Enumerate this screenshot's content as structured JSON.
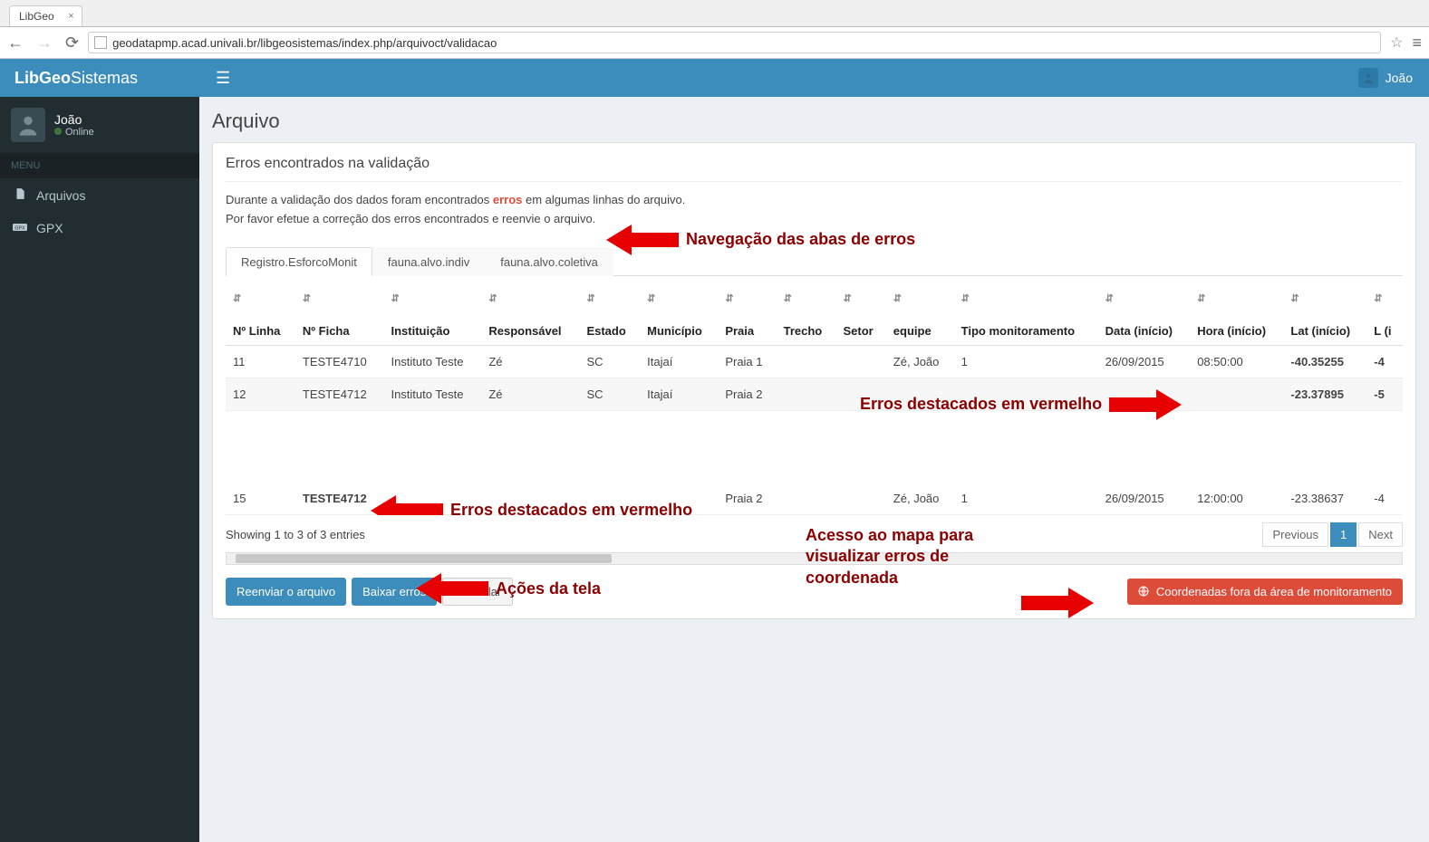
{
  "browser": {
    "tab_title": "LibGeo",
    "url": "geodatapmp.acad.univali.br/libgeosistemas/index.php/arquivoct/validacao"
  },
  "header": {
    "logo_bold": "LibGeo",
    "logo_light": "Sistemas",
    "user": "João"
  },
  "sidebar": {
    "user_name": "João",
    "user_status": "Online",
    "menu_label": "MENU",
    "items": [
      {
        "label": "Arquivos",
        "icon": "file"
      },
      {
        "label": "GPX",
        "icon": "gpx"
      }
    ]
  },
  "main": {
    "page_title": "Arquivo",
    "box_title": "Erros encontrados na validação",
    "info_line1_before": "Durante a validação dos dados foram encontrados ",
    "info_line1_err": "erros",
    "info_line1_after": " em algumas linhas do arquivo.",
    "info_line2": "Por favor efetue a correção dos erros encontrados e reenvie o arquivo.",
    "tabs": [
      {
        "label": "Registro.EsforcoMonit",
        "active": true
      },
      {
        "label": "fauna.alvo.indiv",
        "active": false
      },
      {
        "label": "fauna.alvo.coletiva",
        "active": false
      }
    ],
    "table": {
      "headers": [
        "Nº Linha",
        "Nº Ficha",
        "Instituição",
        "Responsável",
        "Estado",
        "Município",
        "Praia",
        "Trecho",
        "Setor",
        "equipe",
        "Tipo monitoramento",
        "Data (início)",
        "Hora (início)",
        "Lat (início)",
        "L (i"
      ],
      "rows": [
        {
          "linha": "11",
          "ficha": "TESTE4710",
          "ficha_err": false,
          "inst": "Instituto Teste",
          "resp": "Zé",
          "estado": "SC",
          "mun": "Itajaí",
          "praia": "Praia 1",
          "trecho": "",
          "setor": "",
          "equipe": "Zé, João",
          "tipo": "1",
          "data": "26/09/2015",
          "hora": "08:50:00",
          "lat": "-40.35255",
          "lat_err": true,
          "lon": "-4",
          "lon_err": true
        },
        {
          "linha": "12",
          "ficha": "TESTE4712",
          "ficha_err": false,
          "inst": "Instituto Teste",
          "resp": "Zé",
          "estado": "SC",
          "mun": "Itajaí",
          "praia": "Praia 2",
          "trecho": "",
          "setor": "",
          "equipe": "",
          "tipo": "",
          "data": "",
          "hora": "",
          "lat": "-23.37895",
          "lat_err": true,
          "lon": "-5",
          "lon_err": true
        },
        {
          "linha": "15",
          "ficha": "TESTE4712",
          "ficha_err": true,
          "inst": "",
          "resp": "",
          "estado": "",
          "mun": "",
          "praia": "Praia 2",
          "trecho": "",
          "setor": "",
          "equipe": "Zé, João",
          "tipo": "1",
          "data": "26/09/2015",
          "hora": "12:00:00",
          "lat": "-23.38637",
          "lat_err": false,
          "lon": "-4",
          "lon_err": false
        }
      ]
    },
    "entries_info": "Showing 1 to 3 of 3 entries",
    "pagination": {
      "prev": "Previous",
      "page": "1",
      "next": "Next"
    },
    "buttons": {
      "reenviar": "Reenviar o arquivo",
      "baixar": "Baixar erros",
      "cancelar": "Cancelar",
      "coord": "Coordenadas fora da área de monitoramento"
    }
  },
  "annotations": {
    "nav_tabs": "Navegação das abas de erros",
    "err_high1": "Erros destacados em vermelho",
    "err_high2": "Erros destacados em vermelho",
    "actions": "Ações da tela",
    "map_access": "Acesso ao mapa para visualizar erros de coordenada"
  }
}
